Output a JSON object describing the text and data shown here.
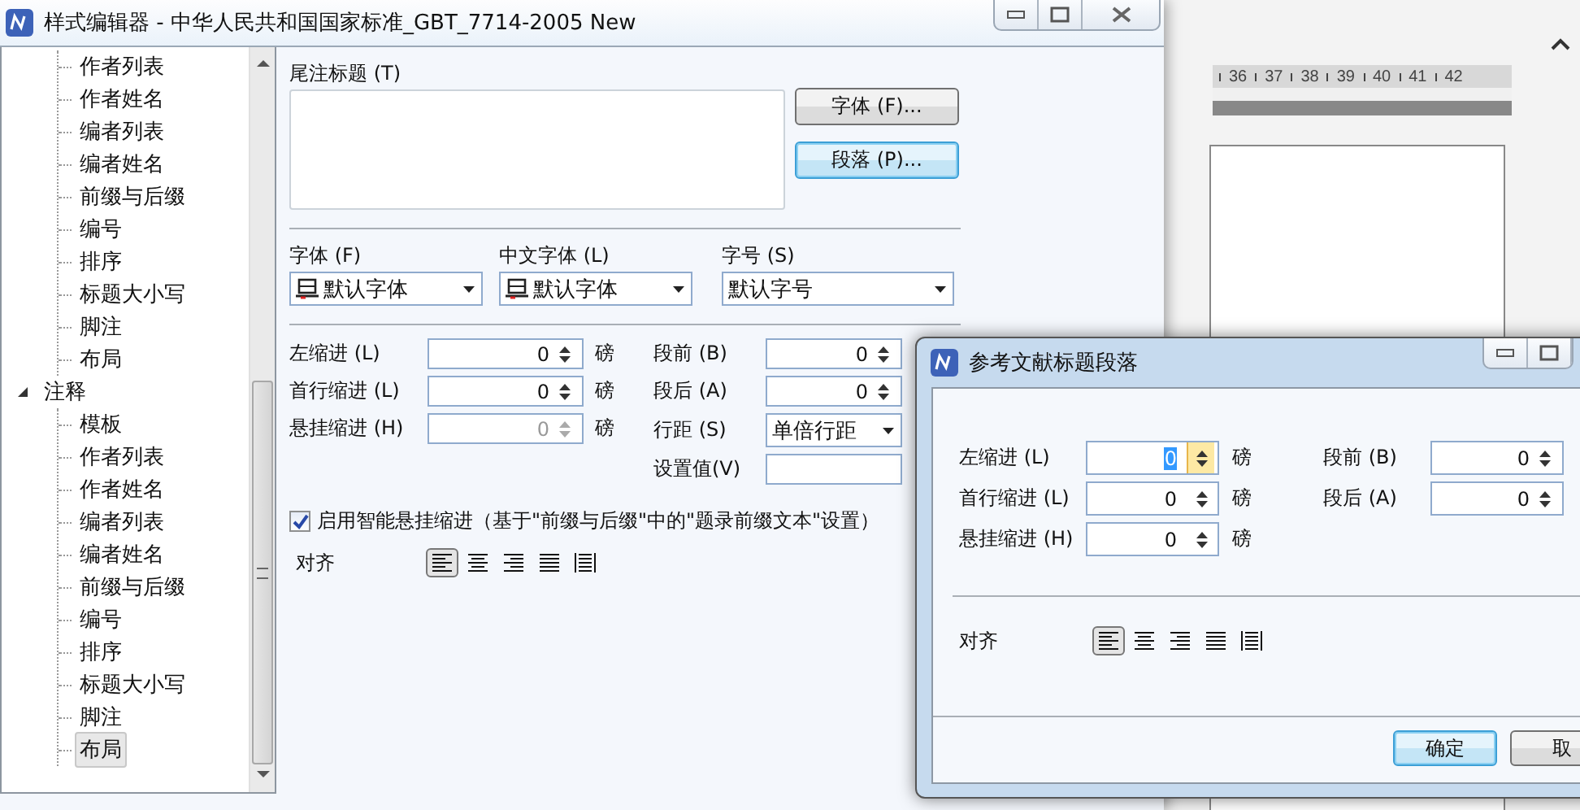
{
  "background_app": {
    "ruler_numbers": [
      "36",
      "37",
      "38",
      "39",
      "40",
      "41",
      "42"
    ]
  },
  "main_window": {
    "title": "样式编辑器 - 中华人民共和国国家标准_GBT_7714-2005 New",
    "tree": [
      {
        "children": [
          {
            "label": "作者列表",
            "selected": false
          },
          {
            "label": "作者姓名",
            "selected": false
          },
          {
            "label": "编者列表",
            "selected": false
          },
          {
            "label": "编者姓名",
            "selected": false
          },
          {
            "label": "前缀与后缀",
            "selected": false
          },
          {
            "label": "编号",
            "selected": false
          },
          {
            "label": "排序",
            "selected": false
          },
          {
            "label": "标题大小写",
            "selected": false
          },
          {
            "label": "脚注",
            "selected": false
          },
          {
            "label": "布局",
            "selected": false
          }
        ]
      },
      {
        "label": "注释",
        "expanded": true,
        "children": [
          {
            "label": "模板",
            "selected": false
          },
          {
            "label": "作者列表",
            "selected": false
          },
          {
            "label": "作者姓名",
            "selected": false
          },
          {
            "label": "编者列表",
            "selected": false
          },
          {
            "label": "编者姓名",
            "selected": false
          },
          {
            "label": "前缀与后缀",
            "selected": false
          },
          {
            "label": "编号",
            "selected": false
          },
          {
            "label": "排序",
            "selected": false
          },
          {
            "label": "标题大小写",
            "selected": false
          },
          {
            "label": "脚注",
            "selected": false
          },
          {
            "label": "布局",
            "selected": true
          }
        ]
      }
    ],
    "endnote_title": {
      "label": "尾注标题 (T)"
    },
    "buttons": [
      {
        "label": "字体 (F)...",
        "focused": false
      },
      {
        "label": "段落 (P)...",
        "focused": true
      }
    ],
    "font_fields": [
      {
        "label": "字体 (F)",
        "value": "默认字体",
        "kind": "font"
      },
      {
        "label": "中文字体 (L)",
        "value": "默认字体",
        "kind": "font"
      },
      {
        "label": "字号 (S)",
        "value": "默认字号",
        "kind": "plain"
      }
    ],
    "indent_fields": [
      {
        "label": "左缩进 (L)",
        "value": "0",
        "unit": "磅",
        "disabled": false
      },
      {
        "label": "首行缩进 (L)",
        "value": "0",
        "unit": "磅",
        "disabled": false
      },
      {
        "label": "悬挂缩进 (H)",
        "value": "0",
        "unit": "磅",
        "disabled": true
      }
    ],
    "spacing_fields": [
      {
        "label": "段前 (B)",
        "value": "0",
        "kind": "spin"
      },
      {
        "label": "段后 (A)",
        "value": "0",
        "kind": "spin"
      },
      {
        "label": "行距 (S)",
        "value": "单倍行距",
        "kind": "dropdown"
      },
      {
        "label": "设置值(V)",
        "kind": "text"
      }
    ],
    "smart_indent": {
      "label": "启用智能悬挂缩进（基于\"前缀与后缀\"中的\"题录前缀文本\"设置）",
      "checked": true
    },
    "alignment_label": "对齐",
    "alignment": [
      {
        "kind": "left",
        "selected": true
      },
      {
        "kind": "center",
        "selected": false
      },
      {
        "kind": "right",
        "selected": false
      },
      {
        "kind": "justify",
        "selected": false
      },
      {
        "kind": "distributed",
        "selected": false
      }
    ]
  },
  "dialog": {
    "title": "参考文献标题段落",
    "indent_fields": [
      {
        "label": "左缩进 (L)",
        "value": "0",
        "unit": "磅",
        "focused": true
      },
      {
        "label": "首行缩进 (L)",
        "value": "0",
        "unit": "磅",
        "focused": false
      },
      {
        "label": "悬挂缩进 (H)",
        "value": "0",
        "unit": "磅",
        "focused": false
      }
    ],
    "spacing_fields": [
      {
        "label": "段前 (B)",
        "value": "0"
      },
      {
        "label": "段后 (A)",
        "value": "0"
      }
    ],
    "alignment_label": "对齐",
    "alignment": [
      {
        "kind": "left",
        "selected": true
      },
      {
        "kind": "center",
        "selected": false
      },
      {
        "kind": "right",
        "selected": false
      },
      {
        "kind": "justify",
        "selected": false
      },
      {
        "kind": "distributed",
        "selected": false
      }
    ],
    "buttons": [
      {
        "label": "确定",
        "focused": true
      },
      {
        "label": "取",
        "focused": false
      }
    ]
  }
}
